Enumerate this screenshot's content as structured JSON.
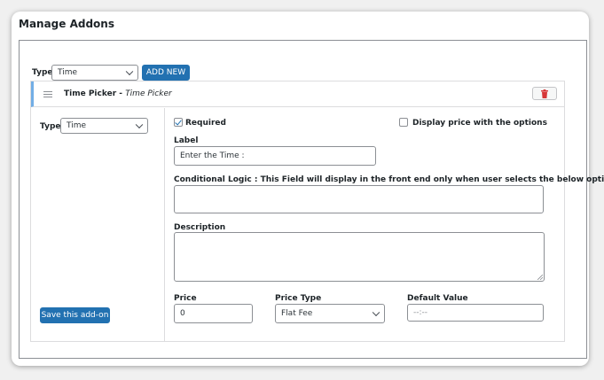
{
  "page": {
    "title": "Manage Addons"
  },
  "top": {
    "type_label": "Type",
    "type_value": "Time",
    "add_new_label": "ADD NEW"
  },
  "addon": {
    "title": "Time Picker",
    "separator": "-",
    "subtitle": "Time Picker",
    "type_label": "Type",
    "type_value": "Time",
    "save_label": "Save this add-on",
    "required_label": "Required",
    "required_checked": true,
    "display_price_label": "Display price with the options",
    "display_price_checked": false,
    "label_heading": "Label",
    "label_value": "Enter the Time :",
    "conditional_heading": "Conditional Logic : This Field will display in the front end only when user selects the below options",
    "conditional_value": "",
    "description_heading": "Description",
    "description_value": "",
    "price_heading": "Price",
    "price_value": "0",
    "price_type_heading": "Price Type",
    "price_type_value": "Flat Fee",
    "default_heading": "Default Value",
    "default_placeholder": "--:--"
  },
  "colors": {
    "accent": "#2271b1",
    "header_stripe": "#72aee6",
    "delete": "#d63638"
  }
}
